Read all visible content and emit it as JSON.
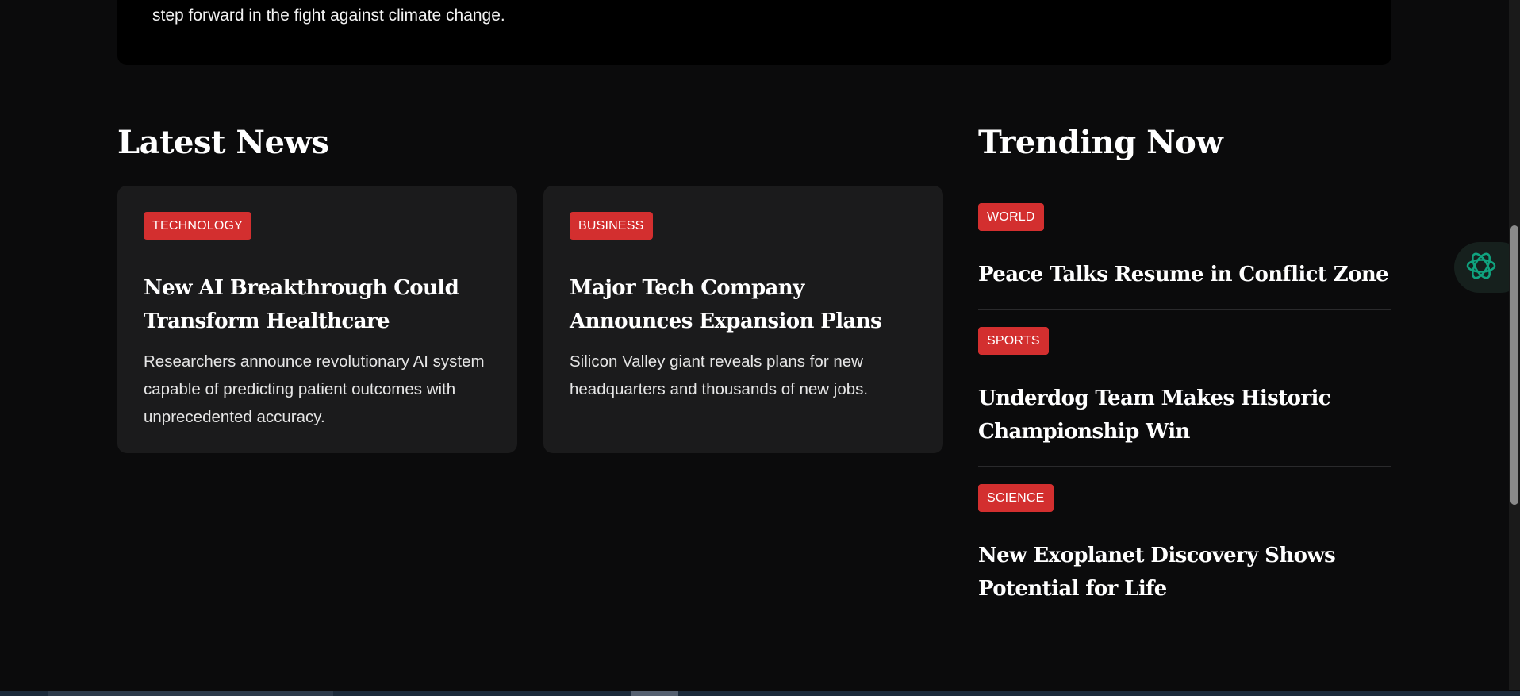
{
  "hero": {
    "text": "step forward in the fight against climate change."
  },
  "latest": {
    "title": "Latest News",
    "cards": [
      {
        "tag": "TECHNOLOGY",
        "title": "New AI Breakthrough Could Transform Healthcare",
        "description": "Researchers announce revolutionary AI system capable of predicting patient outcomes with unprecedented accuracy."
      },
      {
        "tag": "BUSINESS",
        "title": "Major Tech Company Announces Expansion Plans",
        "description": "Silicon Valley giant reveals plans for new headquarters and thousands of new jobs."
      }
    ]
  },
  "trending": {
    "title": "Trending Now",
    "items": [
      {
        "tag": "WORLD",
        "title": "Peace Talks Resume in Conflict Zone"
      },
      {
        "tag": "SPORTS",
        "title": "Underdog Team Makes Historic Championship Win"
      },
      {
        "tag": "SCIENCE",
        "title": "New Exoplanet Discovery Shows Potential for Life"
      }
    ]
  },
  "colors": {
    "background": "#0b0b0c",
    "card": "#1b1b1c",
    "tag": "#d32f2f",
    "assistant_accent": "#10a37f"
  },
  "icons": {
    "assistant": "openai-icon"
  }
}
